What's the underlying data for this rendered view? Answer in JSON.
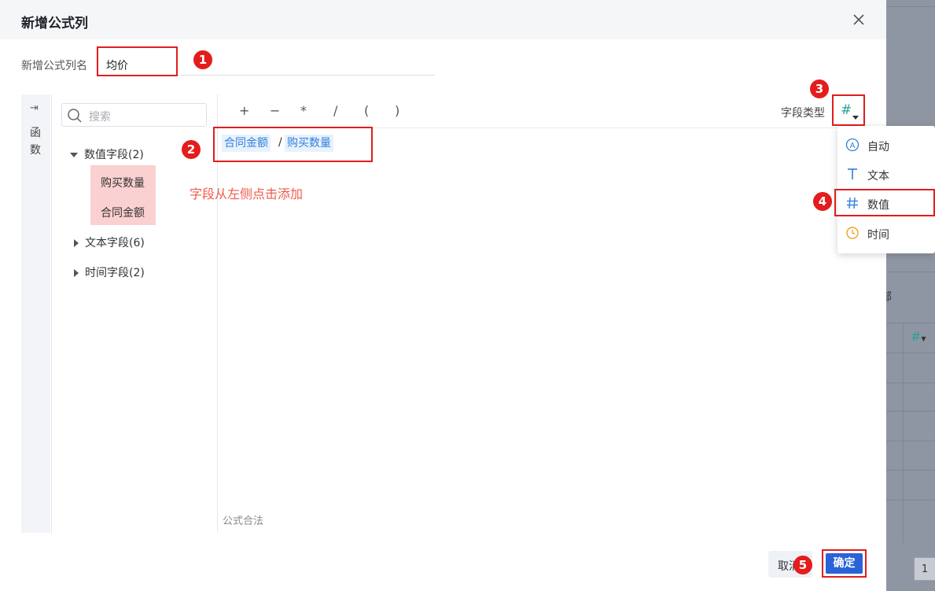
{
  "dialog": {
    "title": "新增公式列",
    "close_icon": "close-icon"
  },
  "column_name": {
    "label": "新增公式列名",
    "value": "均价"
  },
  "function_panel": {
    "label": "函数",
    "expand_icon": "expand-arrow-icon"
  },
  "field_panel": {
    "search_placeholder": "搜索",
    "groups": [
      {
        "label": "数值字段(2)",
        "expanded": true,
        "items": [
          "购买数量",
          "合同金额"
        ]
      },
      {
        "label": "文本字段(6)",
        "expanded": false
      },
      {
        "label": "时间字段(2)",
        "expanded": false
      }
    ]
  },
  "operators": [
    "+",
    "−",
    "*",
    "/",
    "(",
    ")"
  ],
  "field_type": {
    "label": "字段类型",
    "current_icon": "hash-icon",
    "options": [
      {
        "label": "自动",
        "icon": "auto-a-icon"
      },
      {
        "label": "文本",
        "icon": "text-t-icon"
      },
      {
        "label": "数值",
        "icon": "hash-icon"
      },
      {
        "label": "时间",
        "icon": "clock-icon"
      }
    ]
  },
  "formula": {
    "field1": "合同金额",
    "operator": "/",
    "field2": "购买数量",
    "hint": "字段从左侧点击添加",
    "status": "公式合法"
  },
  "footer": {
    "cancel": "取消",
    "confirm": "确定"
  },
  "annotations": [
    "1",
    "2",
    "3",
    "4",
    "5"
  ],
  "background": {
    "partial_text": "部",
    "page_number": "1"
  },
  "colors": {
    "accent": "#2a63d6",
    "annotation_red": "#e21d1d",
    "hint_red": "#f05a4a",
    "chip_blue": "#2f7fdc",
    "number_green": "#2aa198",
    "clock_orange": "#f0a020"
  }
}
